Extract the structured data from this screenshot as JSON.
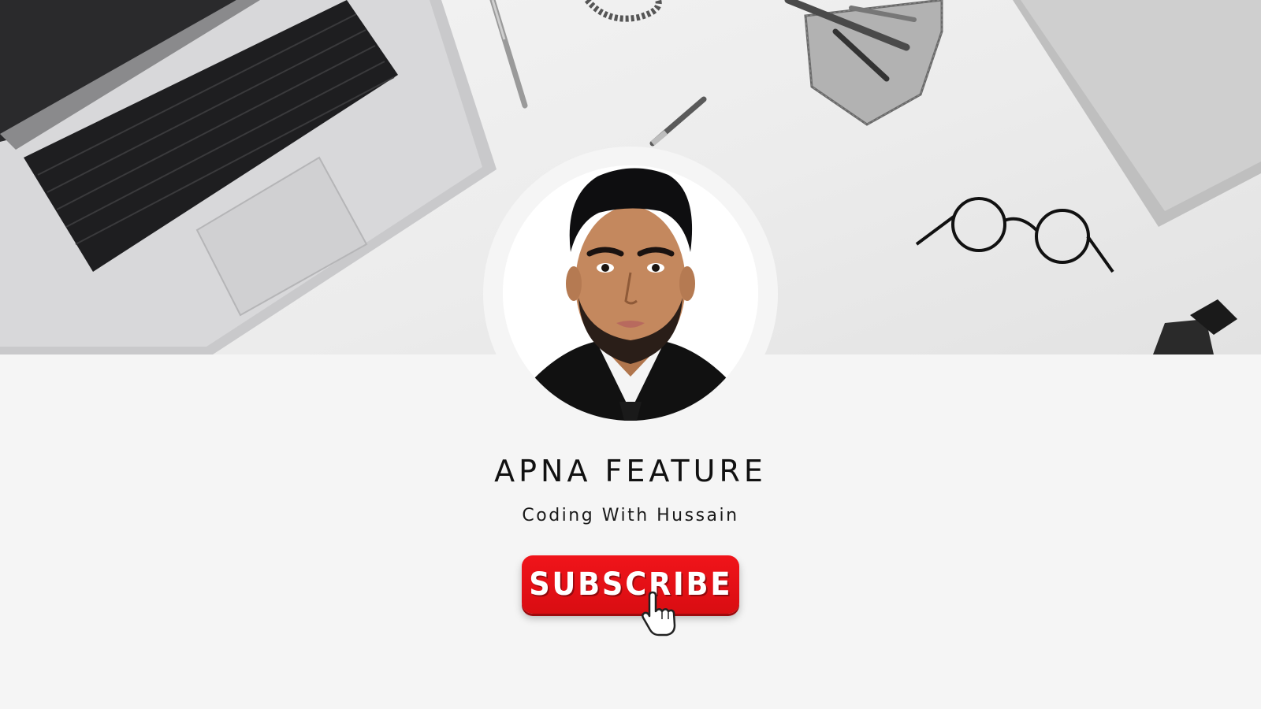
{
  "banner": {
    "scene": "desk-workspace",
    "icons": [
      "laptop-icon",
      "pen-icon",
      "pen-holder-icon",
      "glasses-icon",
      "notebook-icon",
      "cable-icon"
    ]
  },
  "profile": {
    "avatar_icon": "profile-photo",
    "channel_name": "APNA FEATURE",
    "subtitle": "Coding With Hussain"
  },
  "subscribe": {
    "label": "SUBSCRIBE",
    "color": "#e8101a",
    "cursor_icon": "hand-pointer-icon"
  }
}
